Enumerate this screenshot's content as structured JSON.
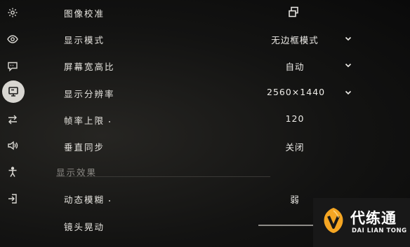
{
  "sidebar": {
    "items": [
      {
        "icon": "gear-icon"
      },
      {
        "icon": "eye-icon"
      },
      {
        "icon": "chat-icon"
      },
      {
        "icon": "monitor-icon",
        "active": true
      },
      {
        "icon": "swap-arrows-icon"
      },
      {
        "icon": "speaker-icon"
      },
      {
        "icon": "accessibility-icon"
      },
      {
        "icon": "exit-icon"
      }
    ]
  },
  "settings": {
    "calibration": {
      "label": "图像校准"
    },
    "display_mode": {
      "label": "显示模式",
      "value": "无边框模式"
    },
    "aspect_ratio": {
      "label": "屏幕宽高比",
      "value": "自动"
    },
    "resolution": {
      "label": "显示分辨率",
      "value": "2560×1440"
    },
    "frame_limit": {
      "label": "帧率上限",
      "value": "120"
    },
    "vsync": {
      "label": "垂直同步",
      "value": "关闭"
    }
  },
  "effects": {
    "section_title": "显示效果",
    "motion_blur": {
      "label": "动态模糊",
      "value": "弱"
    },
    "camera_shake": {
      "label": "镜头晃动"
    }
  },
  "watermark": {
    "name_cn": "代练通",
    "name_en": "DAI LIAN TONG",
    "accent": "#f5a623"
  }
}
